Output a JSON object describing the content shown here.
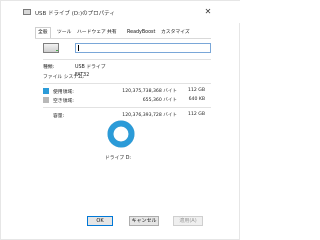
{
  "window": {
    "title": "USB ドライブ (D:)のプロパティ",
    "close_glyph": "✕"
  },
  "tabs": [
    {
      "label": "全般",
      "active": true
    },
    {
      "label": "ツール",
      "active": false
    },
    {
      "label": "ハードウェア",
      "active": false
    },
    {
      "label": "共有",
      "active": false
    },
    {
      "label": "ReadyBoost",
      "active": false
    },
    {
      "label": "カスタマイズ",
      "active": false
    }
  ],
  "general": {
    "volume_name": "",
    "type_label": "種類:",
    "type_value": "USB ドライブ",
    "fs_label": "ファイル システム:",
    "fs_value": "FAT32",
    "used_label": "使用領域:",
    "used_bytes": "120,375,738,368 バイト",
    "used_size": "112 GB",
    "free_label": "空き領域:",
    "free_bytes": "655,360 バイト",
    "free_size": "640 KB",
    "capacity_label": "容量:",
    "capacity_bytes": "120,376,393,728 バイト",
    "capacity_size": "112 GB",
    "drive_label": "ドライブ D:",
    "used_fraction": 0.99999
  },
  "colors": {
    "used": "#2b9bd8",
    "free": "#b8b8b8",
    "accent": "#0078d7"
  },
  "buttons": {
    "ok": "OK",
    "cancel": "キャンセル",
    "apply": "適用(A)"
  }
}
